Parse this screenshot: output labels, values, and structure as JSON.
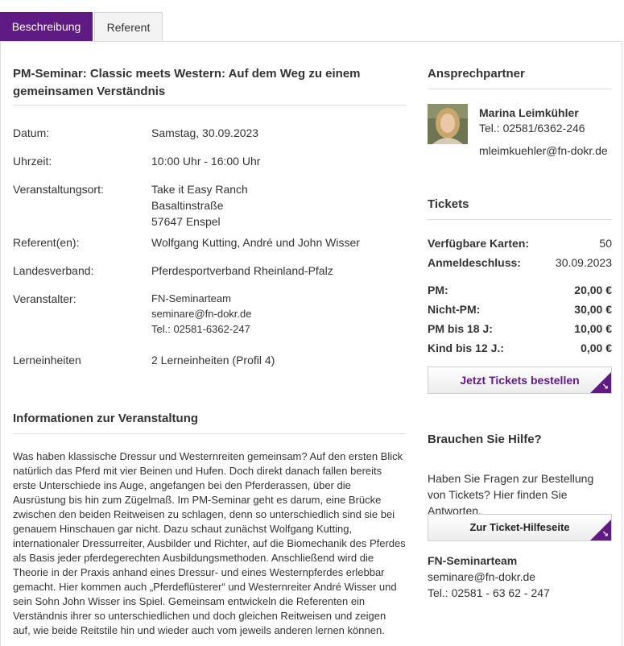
{
  "tabs": [
    {
      "label": "Beschreibung",
      "active": true
    },
    {
      "label": "Referent",
      "active": false
    }
  ],
  "event": {
    "title": "PM-Seminar: Classic meets Western: Auf dem Weg zu einem gemeinsamen Verständnis",
    "rows": {
      "datum": {
        "label": "Datum:",
        "value": "Samstag, 30.09.2023"
      },
      "uhrzeit": {
        "label": "Uhrzeit:",
        "value": "10:00 Uhr - 16:00 Uhr"
      },
      "ort": {
        "label": "Veranstaltungsort:",
        "line1": "Take it Easy Ranch",
        "line2": "Basaltinstraße",
        "line3": "57647 Enspel"
      },
      "referent": {
        "label": "Referent(en):",
        "value": "Wolfgang Kutting, André und John Wisser"
      },
      "landesverband": {
        "label": "Landesverband:",
        "value": "Pferdesportverband Rheinland-Pfalz"
      },
      "veranstalter": {
        "label": "Veranstalter:",
        "line1": "FN-Seminarteam",
        "line2": "seminare@fn-dokr.de",
        "line3": "Tel.: 02581-6362-247"
      },
      "lerneinheiten": {
        "label": "Lerneinheiten",
        "value": "2 Lerneinheiten (Profil 4)"
      }
    },
    "info_heading": "Informationen zur Veranstaltung",
    "description": "Was haben klassische Dressur und Westernreiten gemeinsam? Auf den ersten Blick natürlich das Pferd mit vier Beinen und Hufen. Doch direkt danach fallen bereits erste Unterschiede ins Auge, angefangen bei den Pferderassen, über die Ausrüstung bis hin zum Zügelmaß. Im PM-Seminar geht es darum, eine Brücke zwischen den beiden Reitweisen zu schlagen, denn so unterschiedlich sind sie bei genauem Hinschauen gar nicht. Dazu schaut zunächst Wolfgang Kutting, internationaler Dressurreiter, Ausbilder und Richter, auf die Biomechanik des Pferdes als Basis jeder pferdegerechten Ausbildungsmethoden. Anschließend wird die Theorie in der Praxis anhand eines Dressur- und eines Westernpferdes erlebbar gemacht. Hier kommen auch „Pferdeflüsterer“ und Westernreiter André Wisser und sein Sohn John Wisser ins Spiel. Gemeinsam entwickeln die Referenten ein Verständnis ihrer so unterschiedlichen und doch gleichen Reitweisen und zeigen auf, wie beide Reitstile hin und wieder auch vom jeweils anderen lernen können."
  },
  "contact": {
    "heading": "Ansprechpartner",
    "name": "Marina Leimkühler",
    "tel": "Tel.: 02581/6362-246",
    "email": "mleimkuehler@fn-dokr.de"
  },
  "tickets": {
    "heading": "Tickets",
    "available_label": "Verfügbare Karten:",
    "available_value": "50",
    "deadline_label": "Anmeldeschluss:",
    "deadline_value": "30.09.2023",
    "prices": [
      {
        "label": "PM:",
        "value": "20,00 €"
      },
      {
        "label": "Nicht-PM:",
        "value": "30,00 €"
      },
      {
        "label": "PM bis 18 J:",
        "value": "10,00 €"
      },
      {
        "label": "Kind bis 12 J.:",
        "value": "0,00 €"
      }
    ],
    "order_button": "Jetzt Tickets bestellen"
  },
  "help": {
    "heading": "Brauchen Sie Hilfe?",
    "text": "Haben Sie Fragen zur Bestellung von Tickets? Hier finden Sie Antworten.",
    "button": "Zur Ticket-Hilfeseite",
    "team_name": "FN-Seminarteam",
    "team_email": "seminare@fn-dokr.de",
    "team_tel": "Tel.: 02581 - 63 62 - 247"
  },
  "colors": {
    "accent": "#5f1a83"
  }
}
